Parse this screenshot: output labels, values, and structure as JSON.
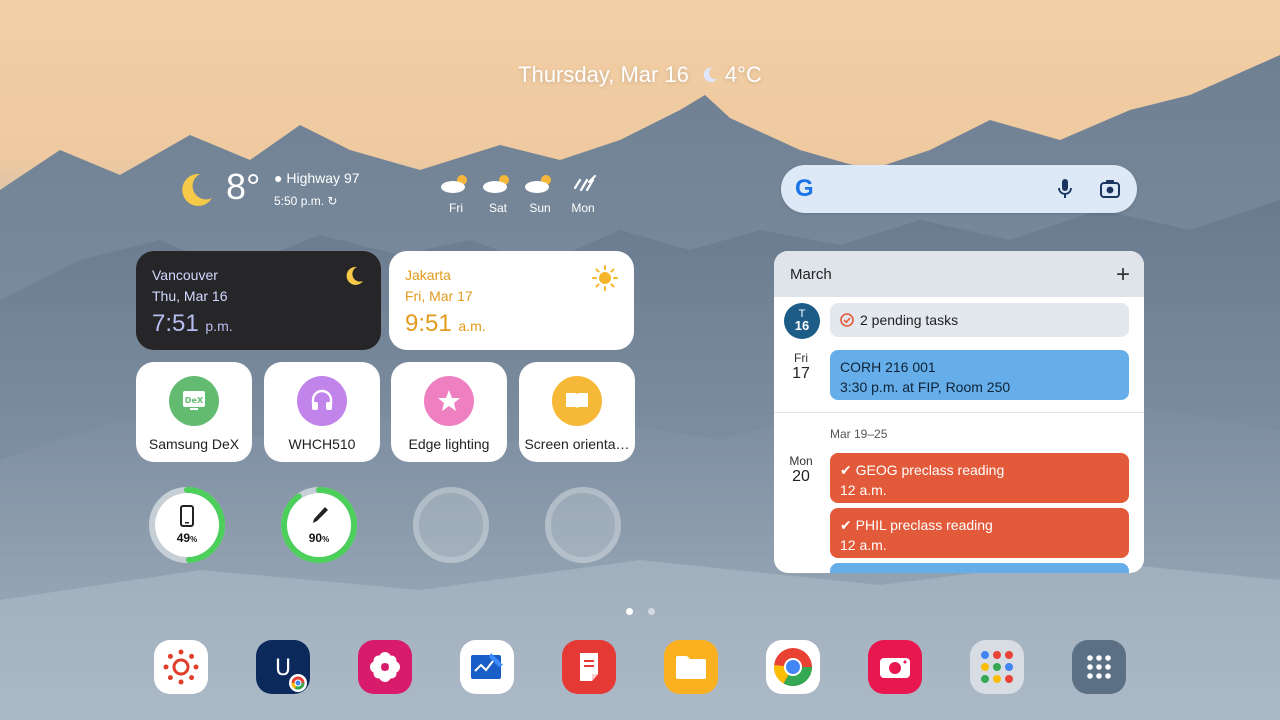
{
  "header": {
    "date_text": "Thursday, Mar 16",
    "temp_text": "4°C"
  },
  "weather": {
    "temp": "8°",
    "location": "Highway 97",
    "updated": "5:50 p.m.",
    "forecast": [
      {
        "day": "Fri",
        "icon": "partly-cloudy-icon"
      },
      {
        "day": "Sat",
        "icon": "partly-cloudy-icon"
      },
      {
        "day": "Sun",
        "icon": "partly-cloudy-icon"
      },
      {
        "day": "Mon",
        "icon": "rain-icon"
      }
    ]
  },
  "clocks": [
    {
      "city": "Vancouver",
      "date": "Thu, Mar 16",
      "time": "7:51",
      "ampm": "p.m.",
      "icon": "moon-icon"
    },
    {
      "city": "Jakarta",
      "date": "Fri, Mar 17",
      "time": "9:51",
      "ampm": "a.m.",
      "icon": "sun-icon"
    }
  ],
  "tiles": [
    {
      "label": "Samsung DeX",
      "icon": "dex-icon",
      "color": "#63bb72"
    },
    {
      "label": "WHCH510",
      "icon": "headphones-icon",
      "color": "#c184ea"
    },
    {
      "label": "Edge lighting",
      "icon": "star-icon",
      "color": "#ee80c1"
    },
    {
      "label": "Screen orienta…",
      "icon": "book-icon",
      "color": "#f6b937"
    }
  ],
  "batteries": [
    {
      "level": 49,
      "label": "49",
      "unit": "%",
      "icon": "tablet-icon"
    },
    {
      "level": 90,
      "label": "90",
      "unit": "%",
      "icon": "pen-icon"
    }
  ],
  "calendar": {
    "month": "March",
    "today_letter": "T",
    "today_num": "16",
    "pending": "2 pending tasks",
    "fri_label": "Fri",
    "fri_num": "17",
    "event1_title": "CORH 216 001",
    "event1_detail": "3:30 p.m. at FIP, Room 250",
    "week_range": "Mar 19–25",
    "mon_label": "Mon",
    "mon_num": "20",
    "event2_title": "GEOG preclass reading",
    "event2_time": "12 a.m.",
    "event3_title": "PHIL preclass reading",
    "event3_time": "12 a.m.",
    "accent_blue": "#66aee9",
    "accent_red": "#e35a3a"
  },
  "dock": [
    {
      "app": "canvas",
      "icon": "canvas-icon"
    },
    {
      "app": "ubc-chrome-shortcut",
      "icon": "u-icon"
    },
    {
      "app": "gallery",
      "icon": "flower-icon"
    },
    {
      "app": "whiteboard",
      "icon": "board-icon"
    },
    {
      "app": "samsung-notes",
      "icon": "notes-icon"
    },
    {
      "app": "my-files",
      "icon": "folder-icon"
    },
    {
      "app": "chrome",
      "icon": "chrome-icon"
    },
    {
      "app": "screen-recorder",
      "icon": "camera-icon"
    },
    {
      "app": "google-folder",
      "icon": "google-folder-icon"
    },
    {
      "app": "app-drawer",
      "icon": "grid-icon"
    }
  ]
}
